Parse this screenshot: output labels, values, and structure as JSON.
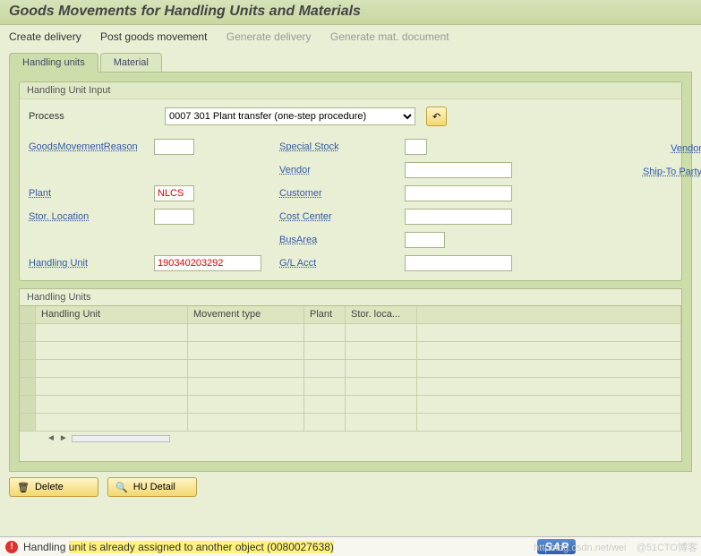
{
  "titlebar": {
    "title": "Goods Movements for Handling Units and Materials"
  },
  "menubar": {
    "items": [
      {
        "label": "Create delivery",
        "enabled": true
      },
      {
        "label": "Post goods movement",
        "enabled": true
      },
      {
        "label": "Generate delivery",
        "enabled": false
      },
      {
        "label": "Generate mat. document",
        "enabled": false
      }
    ]
  },
  "tabs": [
    {
      "label": "Handling units",
      "active": true
    },
    {
      "label": "Material",
      "active": false
    }
  ],
  "hu_input_panel": {
    "title": "Handling Unit Input",
    "process_label": "Process",
    "process_value": "0007 301 Plant transfer (one-step procedure)",
    "left": {
      "goods_reason": {
        "label": "GoodsMovementReason",
        "value": ""
      },
      "plant": {
        "label": "Plant",
        "value": "NLCS"
      },
      "stor_loc": {
        "label": "Stor. Location",
        "value": ""
      },
      "handling_unit": {
        "label": "Handling Unit",
        "value": "190340203292"
      }
    },
    "mid": {
      "special_stock": {
        "label": "Special Stock",
        "value": ""
      },
      "vendor": {
        "label": "Vendor",
        "value": ""
      },
      "customer": {
        "label": "Customer",
        "value": ""
      },
      "cost_center": {
        "label": "Cost Center",
        "value": ""
      },
      "bus_area": {
        "label": "BusArea",
        "value": ""
      },
      "gl_acct": {
        "label": "G/L Acct",
        "value": ""
      }
    },
    "right": {
      "vendor": {
        "label": "Vendor",
        "value": ""
      },
      "ship_to": {
        "label": "Ship-To Party",
        "value": ""
      }
    }
  },
  "hu_table": {
    "title": "Handling Units",
    "columns": [
      "Handling Unit",
      "Movement type",
      "Plant",
      "Stor. loca..."
    ],
    "rows": [
      {},
      {},
      {},
      {},
      {},
      {}
    ]
  },
  "bottom_buttons": {
    "delete": "Delete",
    "hu_detail": "HU Detail"
  },
  "statusbar": {
    "prefix": "Handling ",
    "highlighted": "unit is already assigned to another object (0080027638)",
    "sap": "SAP",
    "watermark_left": "httpblog.csdn.net/wei",
    "watermark_right": "@51CTO博客"
  },
  "icons": {
    "undo": "↶",
    "delete": "🗑",
    "detail": "🔍",
    "resize": "⠿"
  }
}
